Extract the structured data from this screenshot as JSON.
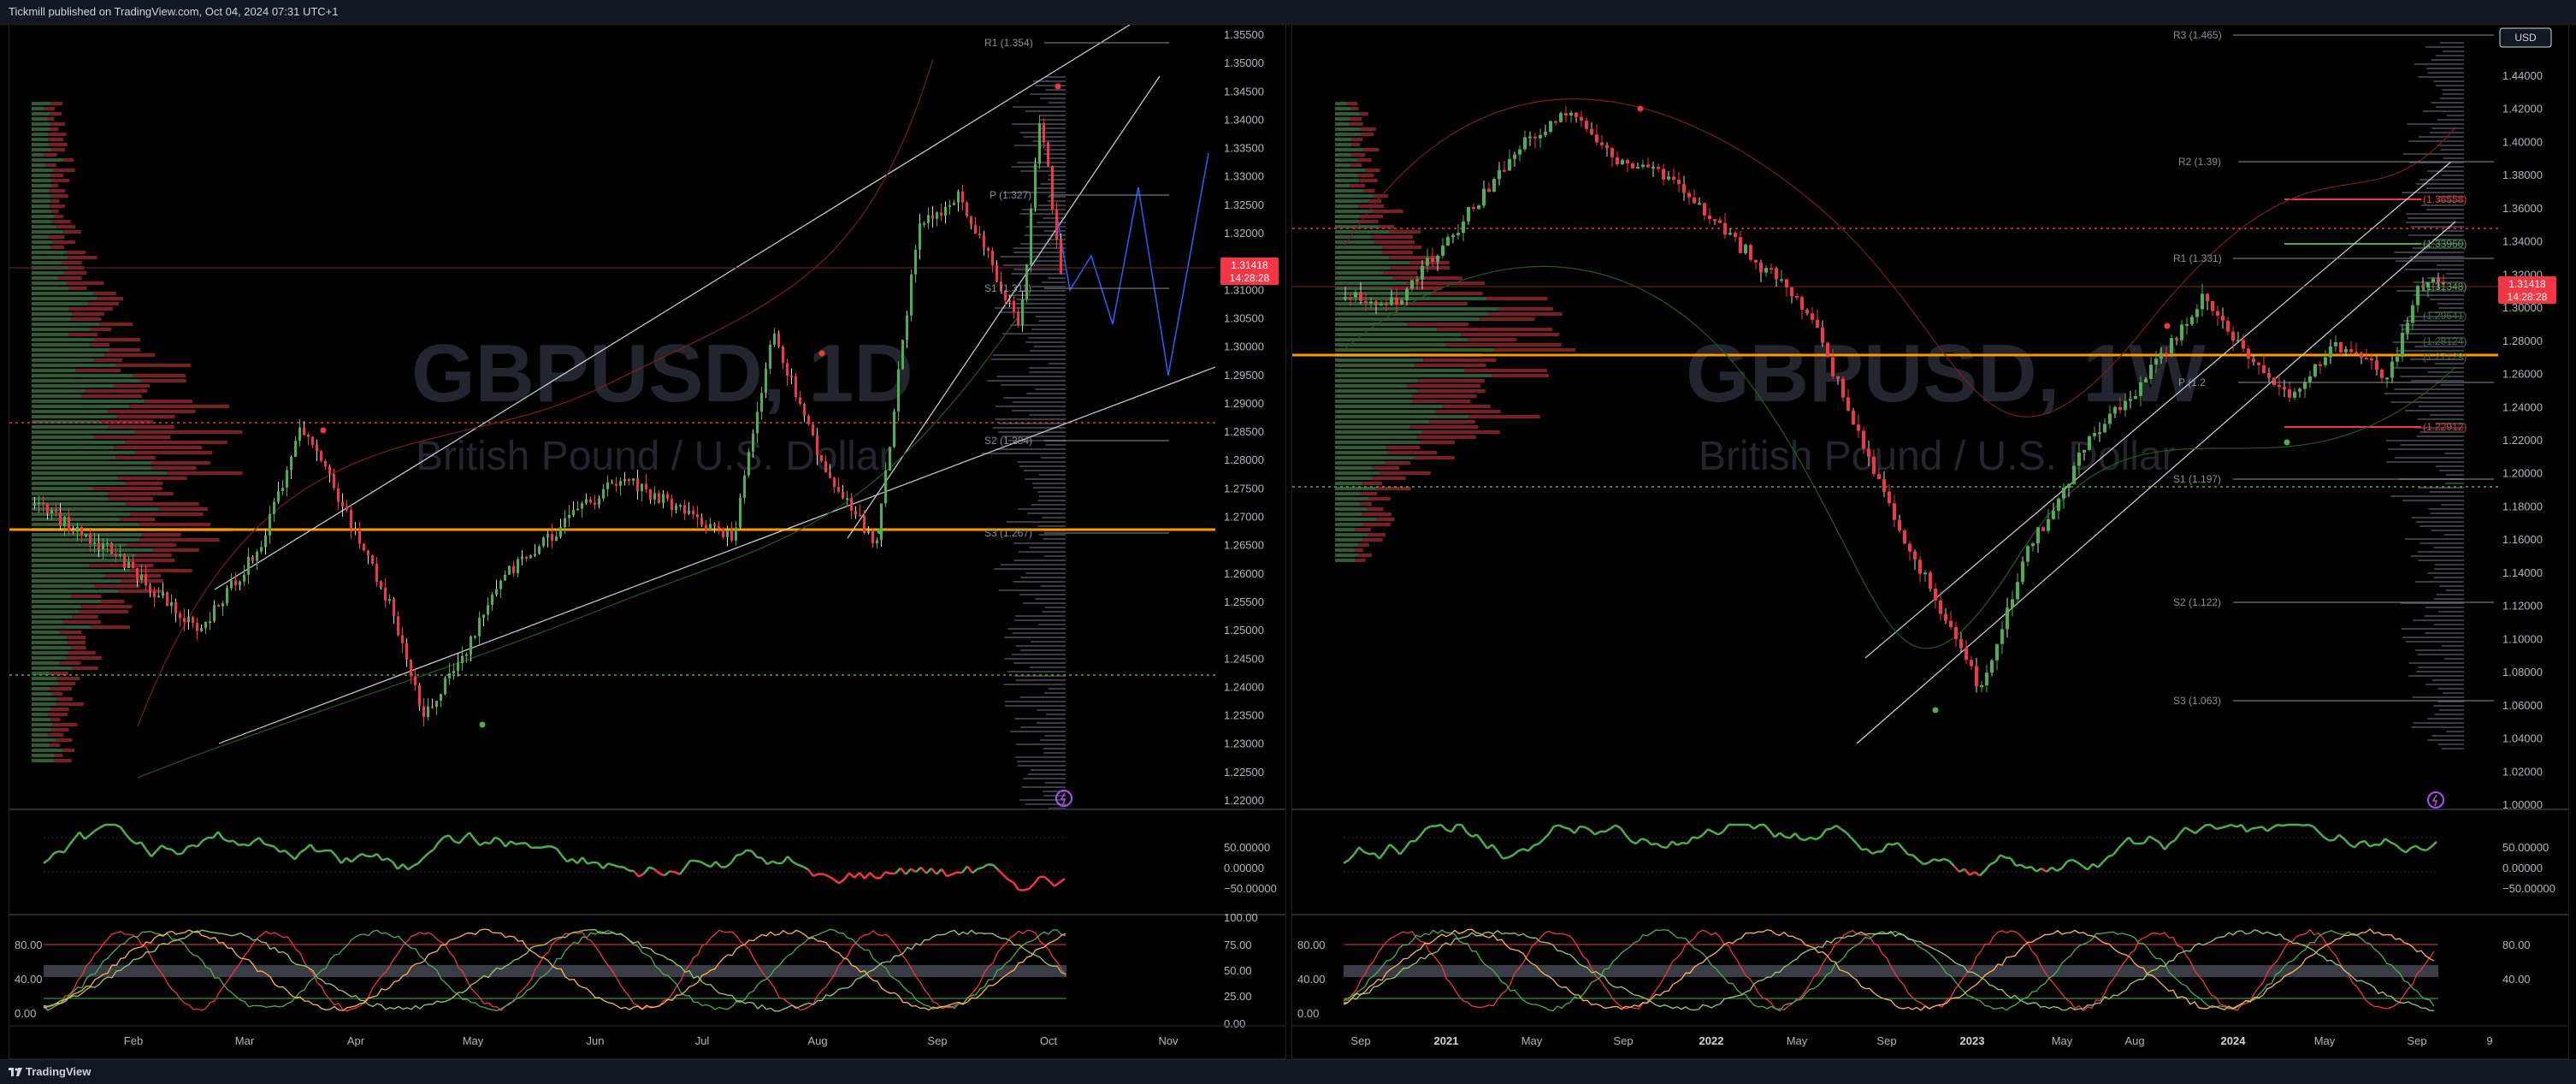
{
  "header": {
    "published": "Tickmill published on TradingView.com, Oct 04, 2024 07:31 UTC+1"
  },
  "footer": {
    "brand": "TradingView"
  },
  "colors": {
    "up": "#4caf50",
    "down": "#f23645",
    "level": "#ff9800",
    "pivot": "#d1d4dc",
    "bg": "#000000"
  },
  "left_chart": {
    "watermark": "GBPUSD, 1D",
    "subtitle": "British Pound / U.S. Dollar",
    "price_label": "1.31418",
    "timer_label": "14:28:28",
    "price_axis": [
      "1.35500",
      "1.35000",
      "1.34500",
      "1.34000",
      "1.33500",
      "1.33000",
      "1.32500",
      "1.32000",
      "1.31500",
      "1.31000",
      "1.30500",
      "1.30000",
      "1.29500",
      "1.29000",
      "1.28500",
      "1.28000",
      "1.27500",
      "1.27000",
      "1.26500",
      "1.26000",
      "1.25500",
      "1.25000",
      "1.24500",
      "1.24000",
      "1.23500",
      "1.23000",
      "1.22500",
      "1.22000"
    ],
    "date_axis": [
      "Feb",
      "Mar",
      "Apr",
      "May",
      "Jun",
      "Jul",
      "Aug",
      "Sep",
      "Oct",
      "Nov"
    ],
    "pivots": [
      "R1 (1.354)",
      "P (1.327)",
      "S1 (1.311)",
      "S2 (1.284)",
      "S3 (1.267)"
    ],
    "osc1_axis": [
      "50.00000",
      "0.00000",
      "−50.00000"
    ],
    "osc2_left": [
      "80.00",
      "40.00",
      "0.00"
    ],
    "osc2_right": [
      "100.00",
      "75.00",
      "50.00",
      "25.00",
      "0.00"
    ]
  },
  "right_chart": {
    "watermark": "GBPUSD, 1W",
    "subtitle": "British Pound / U.S. Dollar",
    "currency": "USD",
    "price_label": "1.31418",
    "timer_label": "14:28:28",
    "price_axis": [
      "1.44000",
      "1.42000",
      "1.40000",
      "1.38000",
      "1.36000",
      "1.34000",
      "1.32000",
      "1.30000",
      "1.28000",
      "1.26000",
      "1.24000",
      "1.22000",
      "1.20000",
      "1.18000",
      "1.16000",
      "1.14000",
      "1.12000",
      "1.10000",
      "1.08000",
      "1.06000",
      "1.04000",
      "1.02000",
      "1.00000"
    ],
    "date_axis": [
      "Sep",
      "2021",
      "May",
      "Sep",
      "2022",
      "May",
      "Sep",
      "2023",
      "May",
      "Aug",
      "2024",
      "May",
      "Sep",
      "9"
    ],
    "pivots": [
      "R3 (1.465)",
      "R2 (1.39)",
      "R1 (1.331)",
      "P (1.2",
      "S1 (1.197)",
      "S2 (1.122)",
      "S3 (1.063)"
    ],
    "levels": [
      "(1.36558)",
      "(1.33960)",
      "(1.31348)",
      "(1.29641)",
      "(1.28124)",
      "(1.27129)",
      "(1.22912)"
    ],
    "osc1_axis": [
      "50.00000",
      "0.00000",
      "−50.00000"
    ],
    "osc2_axis": [
      "80.00",
      "40.00"
    ],
    "osc2_left": [
      "80.00",
      "40.00",
      "0.00"
    ]
  }
}
